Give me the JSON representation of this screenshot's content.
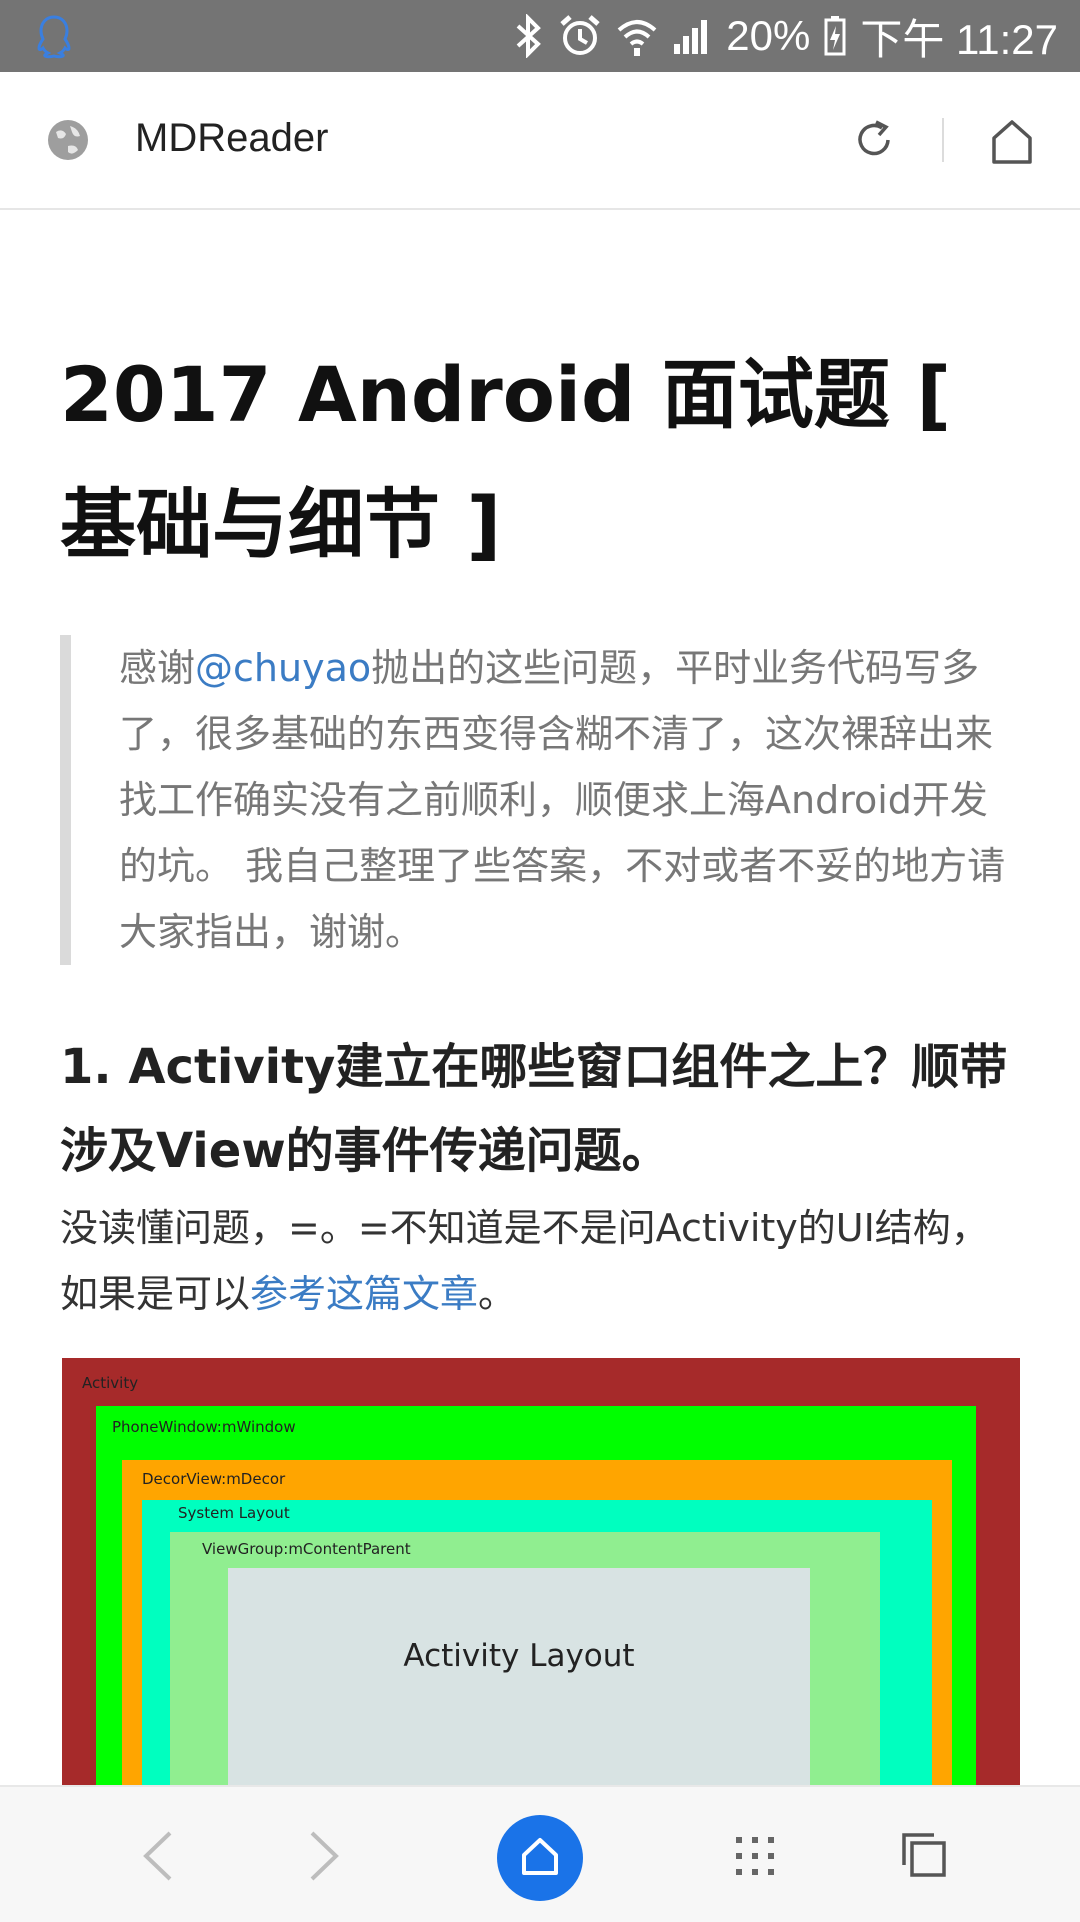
{
  "status_bar": {
    "battery": "20%",
    "time": "下午 11:27",
    "icons": [
      "qq-icon",
      "bluetooth-icon",
      "alarm-icon",
      "wifi-icon",
      "signal-icon",
      "battery-icon"
    ]
  },
  "app_bar": {
    "title": "MDReader",
    "icons": [
      "globe-icon",
      "refresh-icon",
      "home-icon"
    ]
  },
  "article": {
    "title": "2017 Android 面试题 [ 基础与细节 ]",
    "quote": {
      "before_link": "感谢",
      "link": "@chuyao",
      "after_link": "抛出的这些问题，平时业务代码写多了，很多基础的东西变得含糊不清了，这次裸辞出来找工作确实没有之前顺利，顺便求上海Android开发的坑。 我自己整理了些答案，不对或者不妥的地方请大家指出，谢谢。"
    },
    "q1_heading": "1. Activity建立在哪些窗口组件之上？顺带涉及View的事件传递问题。",
    "paragraph": {
      "before_link": "没读懂问题，=。=不知道是不是问Activity的UI结构，如果是可以",
      "link": "参考这篇文章",
      "after_link": "。"
    },
    "diagram": {
      "layers": [
        "Activity",
        "PhoneWindow:mWindow",
        "DecorView:mDecor",
        "System Layout",
        "ViewGroup:mContentParent"
      ],
      "center_label": "Activity Layout",
      "colors": {
        "activity": "#a62a2a",
        "phone_window": "#00ff00",
        "decor_view": "#ffa500",
        "system_layout": "#00ffbf",
        "content_parent": "#90ee90",
        "activity_layout": "#d8e3e3"
      }
    }
  },
  "bottom_bar": {
    "icons": [
      "back-icon",
      "forward-icon",
      "home-icon",
      "grid-menu-icon",
      "tabs-icon"
    ],
    "accent": "#1a73e8"
  }
}
